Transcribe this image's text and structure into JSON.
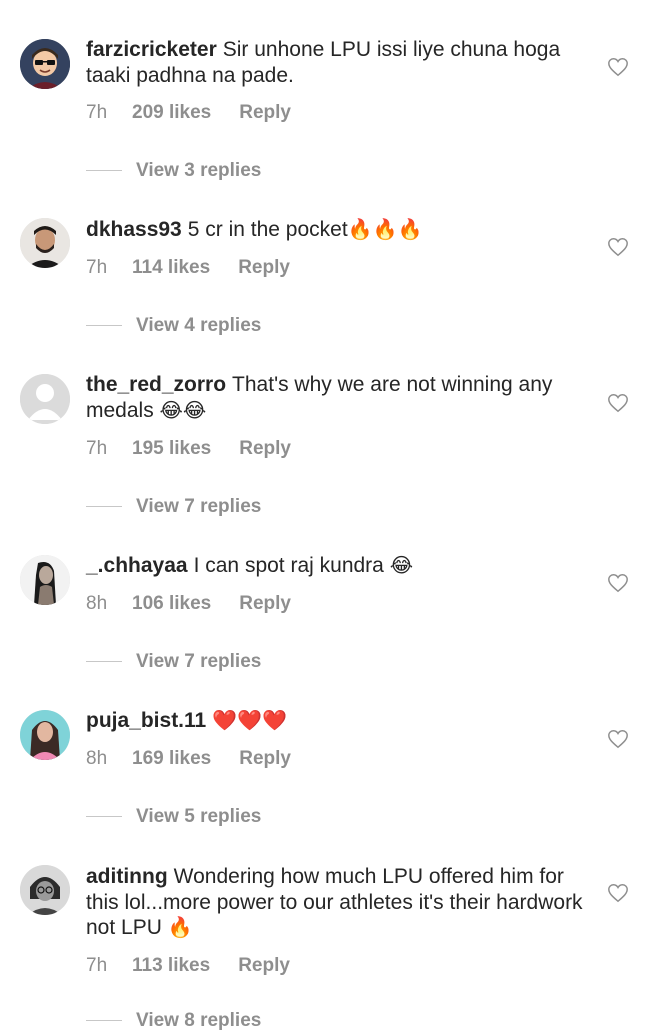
{
  "comments": [
    {
      "username": "farzicricketer",
      "text": "Sir unhone LPU issi liye chuna hoga taaki padhna na pade.",
      "emoji": "",
      "time": "7h",
      "likes": "209 likes",
      "reply_label": "Reply",
      "view_replies": "View 3 replies",
      "avatar": "cartoon-avatar"
    },
    {
      "username": "dkhass93",
      "text": "5 cr in the pocket",
      "emoji": "🔥🔥🔥",
      "time": "7h",
      "likes": "114 likes",
      "reply_label": "Reply",
      "view_replies": "View 4 replies",
      "avatar": "photo-avatar"
    },
    {
      "username": "the_red_zorro",
      "text": "That's why we are not winning any medals",
      "emoji": "😂😂",
      "time": "7h",
      "likes": "195 likes",
      "reply_label": "Reply",
      "view_replies": "View 7 replies",
      "avatar": "default-avatar"
    },
    {
      "username": "_.chhayaa",
      "text": "I can spot raj kundra",
      "emoji": "😂",
      "time": "8h",
      "likes": "106 likes",
      "reply_label": "Reply",
      "view_replies": "View 7 replies",
      "avatar": "photo-avatar"
    },
    {
      "username": "puja_bist.11",
      "text": "",
      "emoji": "❤️❤️❤️",
      "time": "8h",
      "likes": "169 likes",
      "reply_label": "Reply",
      "view_replies": "View 5 replies",
      "avatar": "photo-avatar"
    },
    {
      "username": "aditinng",
      "text": "Wondering how much LPU offered him for this lol...more power to our athletes it's their hardwork not LPU",
      "emoji": "🔥",
      "time": "7h",
      "likes": "113 likes",
      "reply_label": "Reply",
      "view_replies": "View 8 replies",
      "avatar": "photo-avatar"
    }
  ],
  "icons": {
    "like": "heart-outline-icon"
  },
  "colors": {
    "text": "#262626",
    "secondary": "#8e8e8e",
    "divider": "#c7c7c7"
  }
}
